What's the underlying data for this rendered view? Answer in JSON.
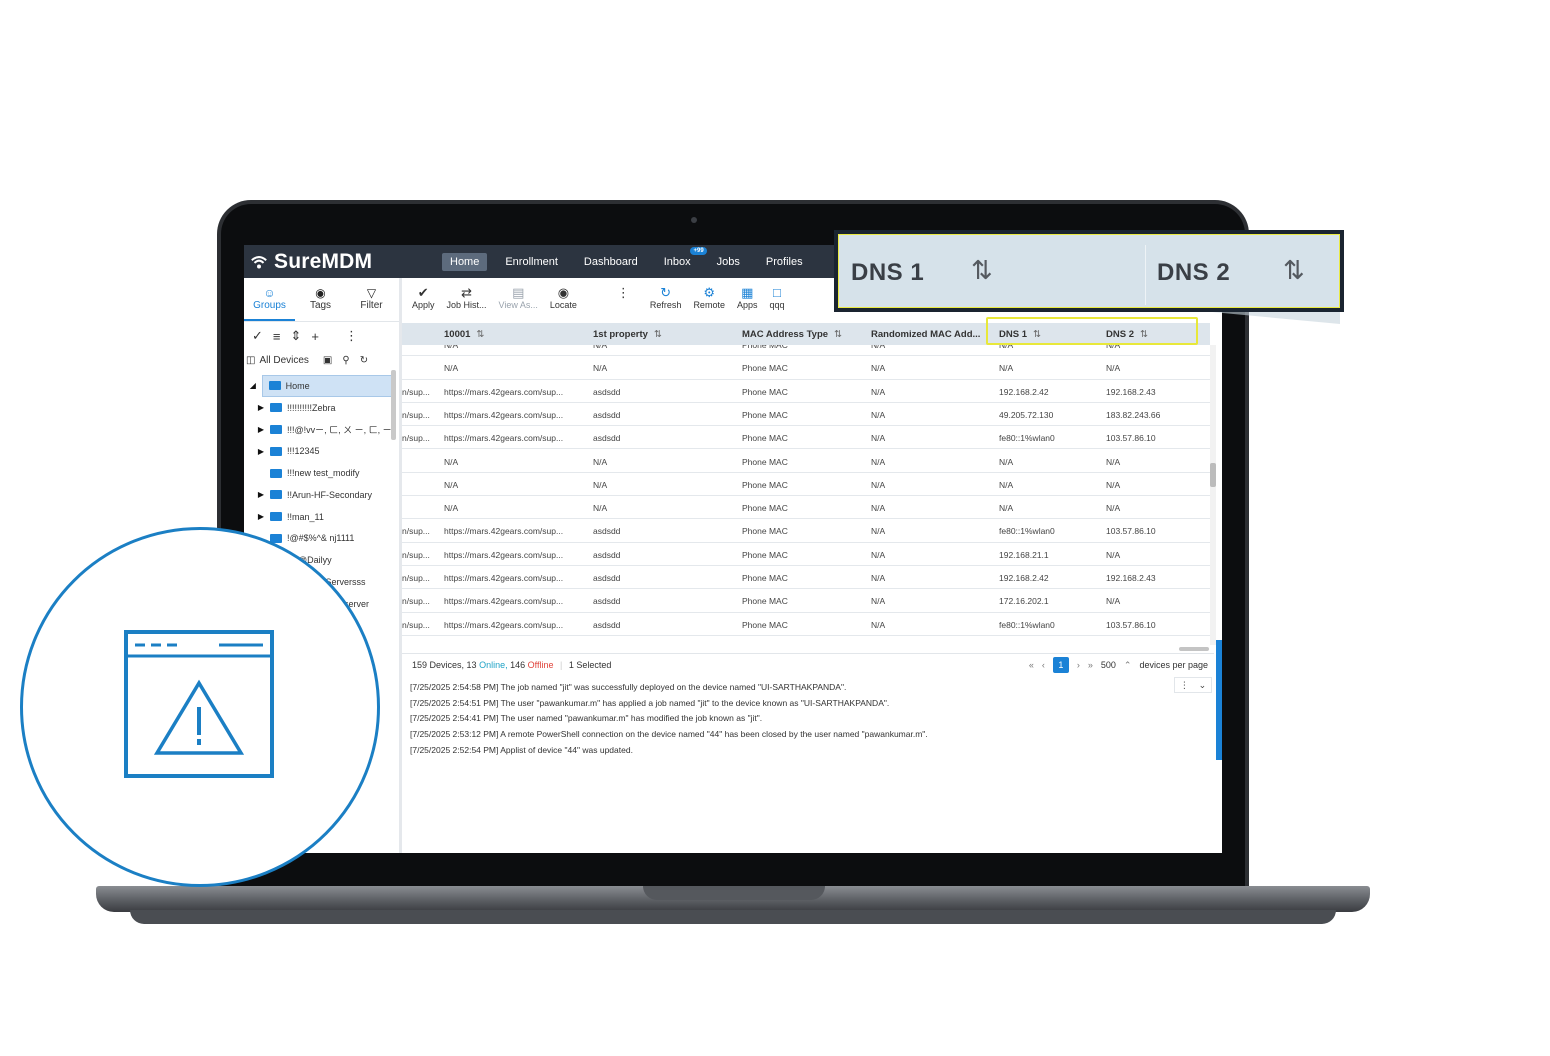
{
  "app": {
    "name": "SureMDM"
  },
  "nav": [
    {
      "label": "Home",
      "active": true
    },
    {
      "label": "Enrollment"
    },
    {
      "label": "Dashboard"
    },
    {
      "label": "Inbox",
      "badge": "+99"
    },
    {
      "label": "Jobs"
    },
    {
      "label": "Profiles"
    }
  ],
  "left_tabs": [
    {
      "label": "Groups",
      "icon": "groups-icon",
      "active": true
    },
    {
      "label": "Tags",
      "icon": "tag-icon"
    },
    {
      "label": "Filter",
      "icon": "filter-icon"
    }
  ],
  "all_devices": "All Devices",
  "tree": [
    {
      "label": "Home",
      "selected": true
    },
    {
      "label": "!!!!!!!!!!Zebra",
      "expandable": true
    },
    {
      "label": "!!!@!vvㄧ, ㄈ, ㄨ ㄧ, ㄈ, ㄧ",
      "expandable": true
    },
    {
      "label": "!!!12345",
      "expandable": true
    },
    {
      "label": "!!!new test_modify",
      "expandable": false
    },
    {
      "label": "!!Arun-HF-Secondary",
      "expandable": true
    },
    {
      "label": "!!man_11",
      "expandable": true
    },
    {
      "label": "!@#$%^& nj1111",
      "expandable": false
    },
    {
      "label": "@Dailyy",
      "expandable": false
    },
    {
      "label": "layServersss",
      "expandable": false
    },
    {
      "label": "server",
      "expandable": false
    }
  ],
  "toolbar": [
    {
      "label": "Apply",
      "icon": "check-circle-icon"
    },
    {
      "label": "Job Hist...",
      "icon": "list-icon"
    },
    {
      "label": "View As...",
      "icon": "document-icon",
      "disabled": true
    },
    {
      "label": "Locate",
      "icon": "location-pin-icon"
    },
    {
      "label": "",
      "icon": "more-vertical-icon"
    },
    {
      "label": "Refresh",
      "icon": "refresh-icon"
    },
    {
      "label": "Remote",
      "icon": "remote-icon"
    },
    {
      "label": "Apps",
      "icon": "apps-grid-icon"
    },
    {
      "label": "qqq",
      "icon": "calendar-icon"
    }
  ],
  "grid": {
    "columns": [
      "10001",
      "1st property",
      "MAC Address Type",
      "Randomized MAC Add...",
      "DNS 1",
      "DNS 2"
    ],
    "rows": [
      [
        "",
        "N/A",
        "N/A",
        "Phone MAC",
        "N/A",
        "N/A",
        "N/A"
      ],
      [
        "",
        "N/A",
        "N/A",
        "Phone MAC",
        "N/A",
        "N/A",
        "N/A"
      ],
      [
        "n/sup...",
        "https://mars.42gears.com/sup...",
        "asdsdd",
        "Phone MAC",
        "N/A",
        "192.168.2.42",
        "192.168.2.43"
      ],
      [
        "n/sup...",
        "https://mars.42gears.com/sup...",
        "asdsdd",
        "Phone MAC",
        "N/A",
        "49.205.72.130",
        "183.82.243.66"
      ],
      [
        "n/sup...",
        "https://mars.42gears.com/sup...",
        "asdsdd",
        "Phone MAC",
        "N/A",
        "fe80::1%wlan0",
        "103.57.86.10"
      ],
      [
        "",
        "N/A",
        "N/A",
        "Phone MAC",
        "N/A",
        "N/A",
        "N/A"
      ],
      [
        "",
        "N/A",
        "N/A",
        "Phone MAC",
        "N/A",
        "N/A",
        "N/A"
      ],
      [
        "",
        "N/A",
        "N/A",
        "Phone MAC",
        "N/A",
        "N/A",
        "N/A"
      ],
      [
        "n/sup...",
        "https://mars.42gears.com/sup...",
        "asdsdd",
        "Phone MAC",
        "N/A",
        "fe80::1%wlan0",
        "103.57.86.10"
      ],
      [
        "n/sup...",
        "https://mars.42gears.com/sup...",
        "asdsdd",
        "Phone MAC",
        "N/A",
        "192.168.21.1",
        "N/A"
      ],
      [
        "n/sup...",
        "https://mars.42gears.com/sup...",
        "asdsdd",
        "Phone MAC",
        "N/A",
        "192.168.2.42",
        "192.168.2.43"
      ],
      [
        "n/sup...",
        "https://mars.42gears.com/sup...",
        "asdsdd",
        "Phone MAC",
        "N/A",
        "172.16.202.1",
        "N/A"
      ],
      [
        "n/sup...",
        "https://mars.42gears.com/sup...",
        "asdsdd",
        "Phone MAC",
        "N/A",
        "fe80::1%wlan0",
        "103.57.86.10"
      ]
    ]
  },
  "status": {
    "devices": "159 Devices,",
    "online_count": "13",
    "online_label": "Online,",
    "offline_count": "146",
    "offline_label": "Offline",
    "selected": "1 Selected",
    "page": "1",
    "page_size": "500",
    "page_size_label": "devices per page"
  },
  "log": [
    "[7/25/2025 2:54:58 PM] The job named \"jit\" was successfully deployed on the device named \"UI-SARTHAKPANDA\".",
    "[7/25/2025 2:54:51 PM] The user \"pawankumar.m\" has applied a job named \"jit\" to the device known as \"UI-SARTHAKPANDA\".",
    "[7/25/2025 2:54:41 PM] The user named \"pawankumar.m\" has modified the job known as \"jit\".",
    "[7/25/2025 2:53:12 PM] A remote PowerShell connection on the device named \"44\" has been closed by the user named \"pawankumar.m\".",
    "[7/25/2025 2:52:54 PM] Applist of device \"44\" was updated."
  ],
  "callout": {
    "col1": "DNS 1",
    "col2": "DNS 2"
  },
  "colors": {
    "accent": "#1b82d6",
    "topbar": "#2c3440",
    "online": "#1fa3c6",
    "offline": "#e0433b",
    "highlight": "#e8e83a"
  }
}
